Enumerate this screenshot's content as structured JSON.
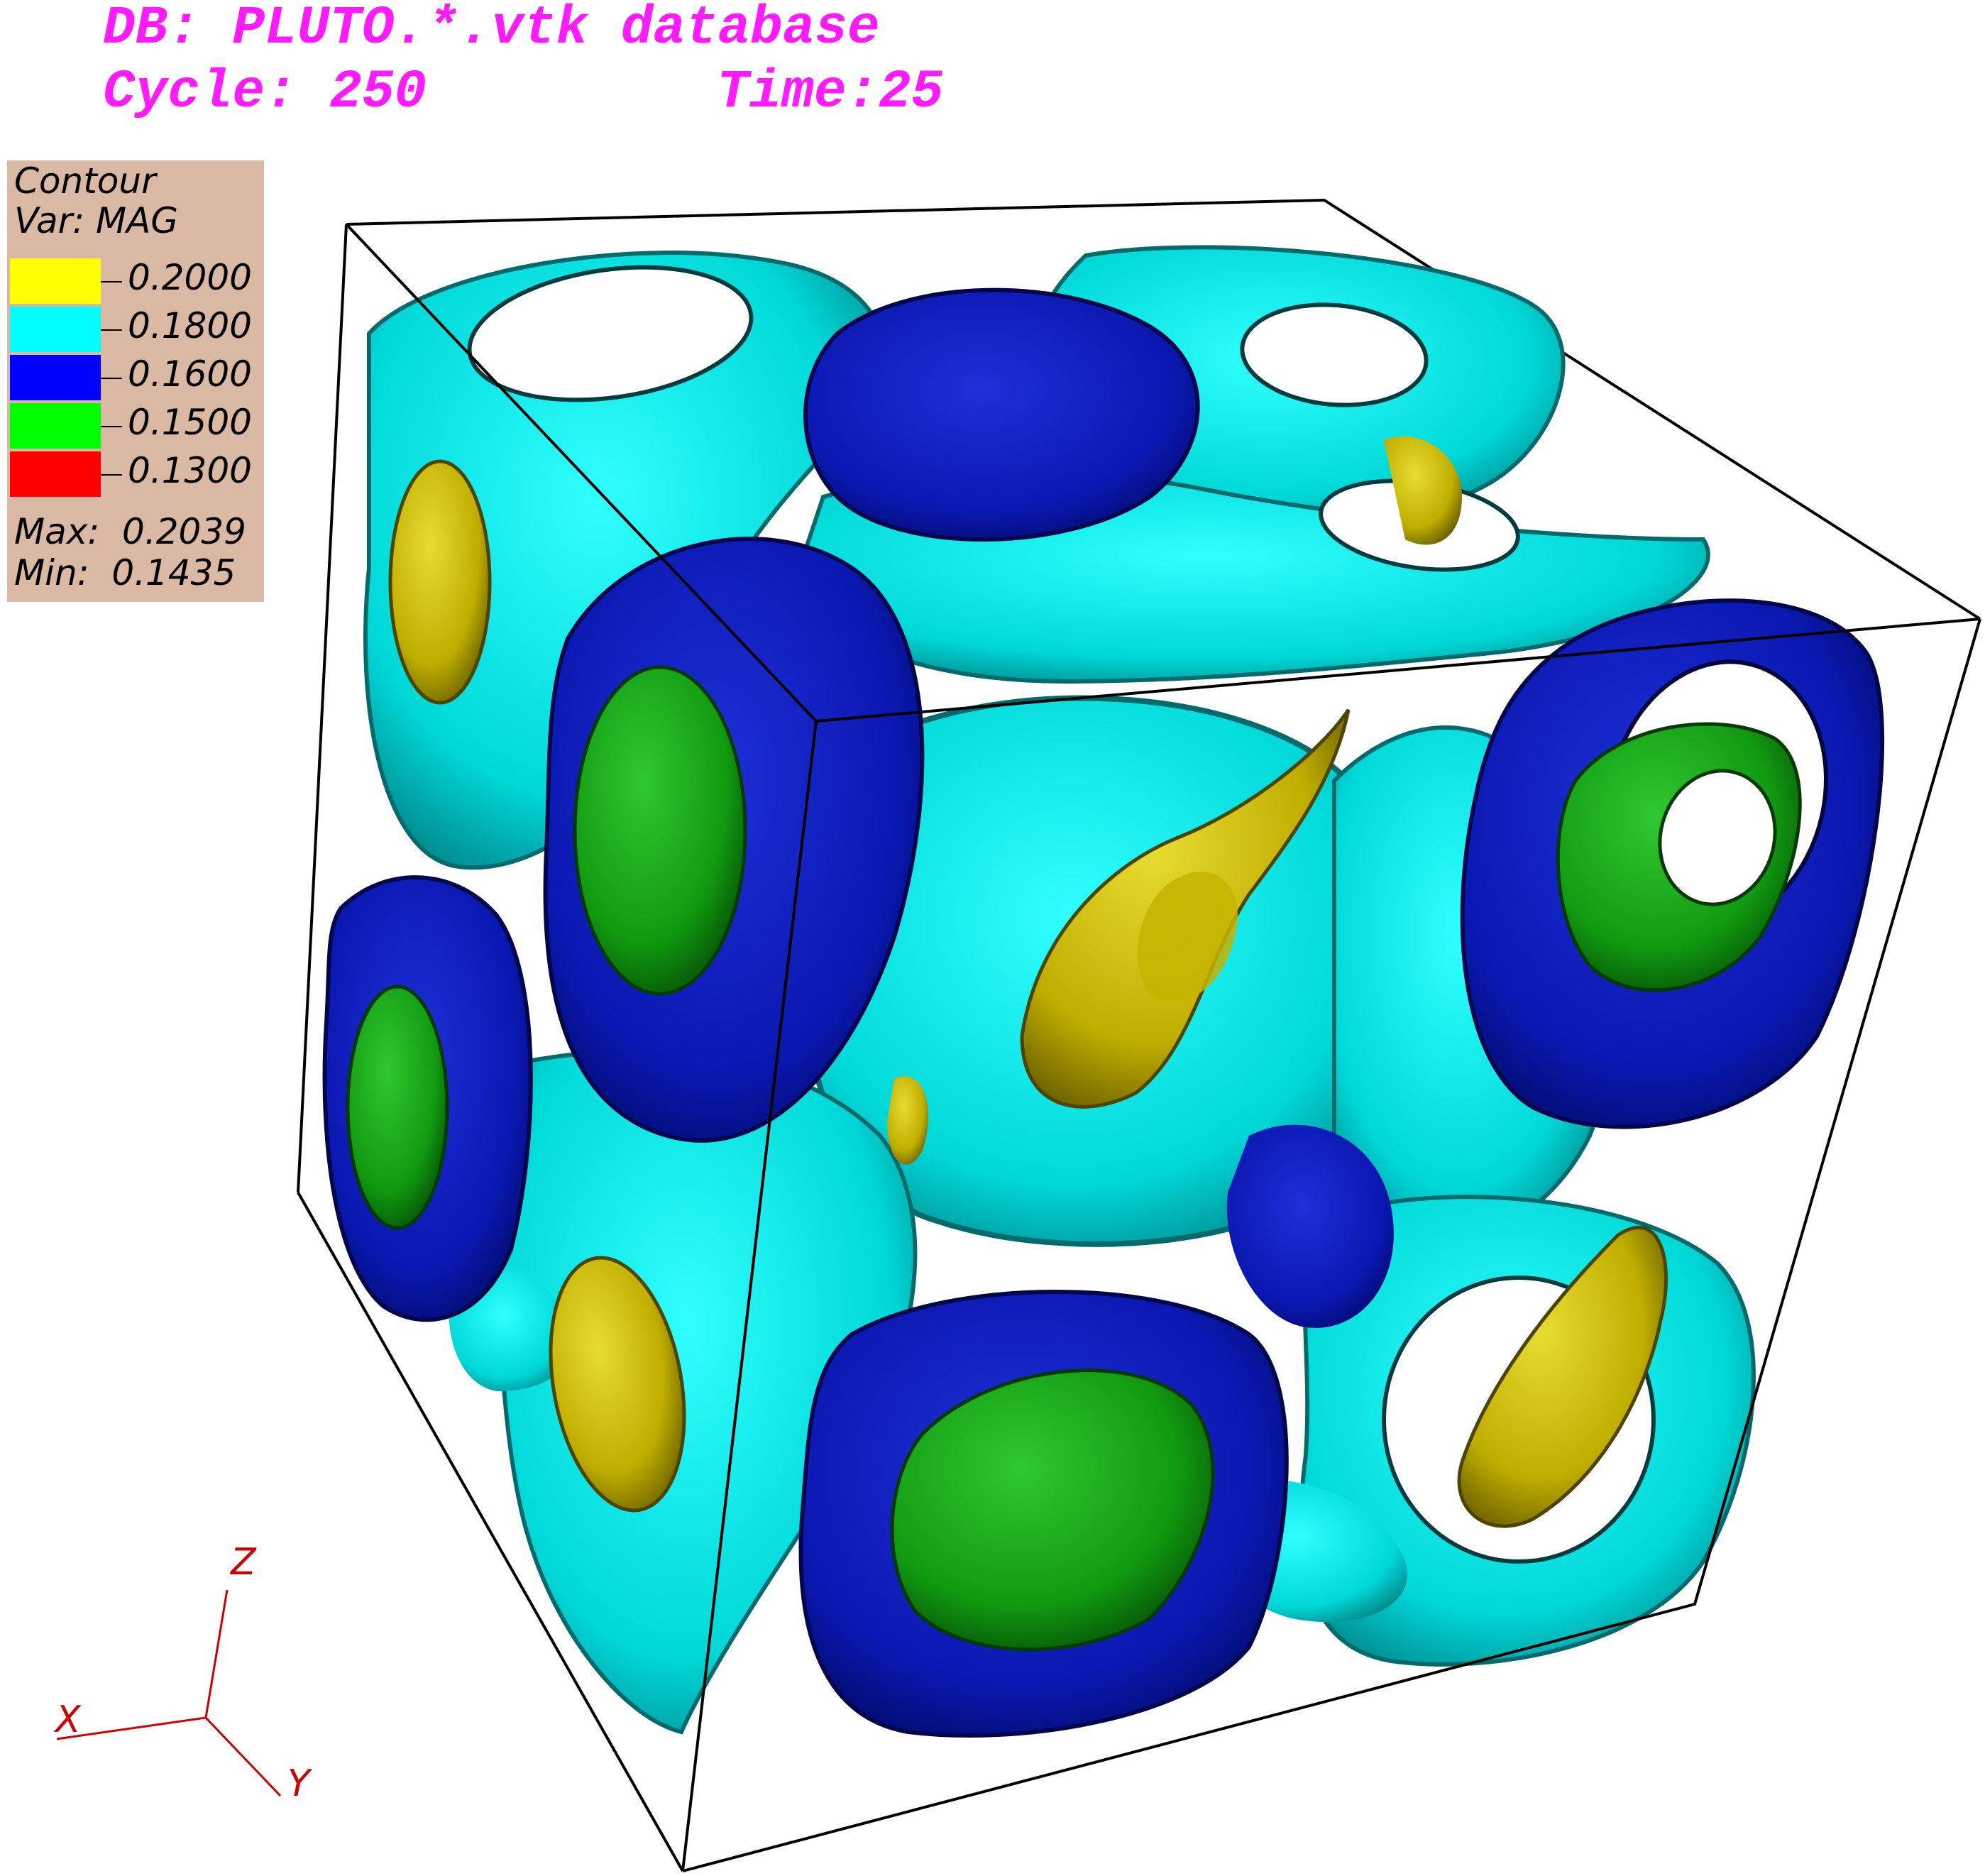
{
  "header": {
    "db_line": "DB: PLUTO.*.vtk database",
    "cycle_line": "Cycle: 250",
    "time_line": "Time:25"
  },
  "legend": {
    "title": "Contour",
    "var": "Var: MAG",
    "entries": [
      {
        "value": "0.2000",
        "color": "#ffff00"
      },
      {
        "value": "0.1800",
        "color": "#00ffff"
      },
      {
        "value": "0.1600",
        "color": "#0000ff"
      },
      {
        "value": "0.1500",
        "color": "#00ff00"
      },
      {
        "value": "0.1300",
        "color": "#ff0000"
      }
    ],
    "max_line": "Max:  0.2039",
    "min_line": "Min:  0.1435"
  },
  "triad": {
    "x": "X",
    "y": "Y",
    "z": "Z"
  },
  "surface_colors": {
    "cyan": "#00dede",
    "cyan_dark": "#00a8a8",
    "blue": "#0a18b4",
    "blue_dark": "#000a6e",
    "yellow": "#c4b400",
    "green": "#13a013",
    "frame": "#000000"
  }
}
